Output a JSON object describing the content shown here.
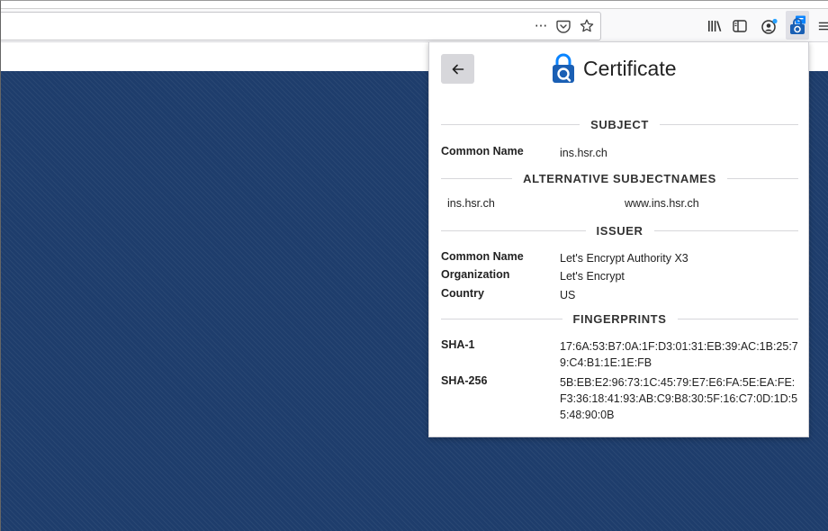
{
  "toolbar": {
    "page_actions_icon": "more-horiz-icon",
    "page_actions_label": "···",
    "pocket_icon": "pocket-icon",
    "bookmark_icon": "star-icon",
    "library_icon": "library-icon",
    "sidebar_icon": "sidebar-icon",
    "account_icon": "account-icon",
    "extension_icon": "certificate-extension-icon",
    "menu_icon": "hamburger-menu-icon"
  },
  "panel": {
    "title": "Certificate",
    "back_icon": "back-arrow-icon",
    "subject": {
      "heading": "SUBJECT",
      "rows": [
        {
          "key": "Common Name",
          "value": "ins.hsr.ch"
        }
      ]
    },
    "alt_names": {
      "heading": "ALTERNATIVE SUBJECTNAMES",
      "names": [
        "ins.hsr.ch",
        "www.ins.hsr.ch"
      ]
    },
    "issuer": {
      "heading": "ISSUER",
      "rows": [
        {
          "key": "Common Name",
          "value": "Let's Encrypt Authority X3"
        },
        {
          "key": "Organization",
          "value": "Let's Encrypt"
        },
        {
          "key": "Country",
          "value": "US"
        }
      ]
    },
    "fingerprints": {
      "heading": "FINGERPRINTS",
      "rows": [
        {
          "key": "SHA-1",
          "value": "17:6A:53:B7:0A:1F:D3:01:31:EB:39:AC:1B:25:79:C4:B1:1E:1E:FB"
        },
        {
          "key": "SHA-256",
          "value": "5B:EB:E2:96:73:1C:45:79:E7:E6:FA:5E:EA:FE:F3:36:18:41:93:AB:C9:B8:30:5F:16:C7:0D:1D:55:48:90:0B"
        }
      ]
    }
  },
  "colors": {
    "page_background": "#1e3d6c",
    "accent": "#0a84ff"
  }
}
